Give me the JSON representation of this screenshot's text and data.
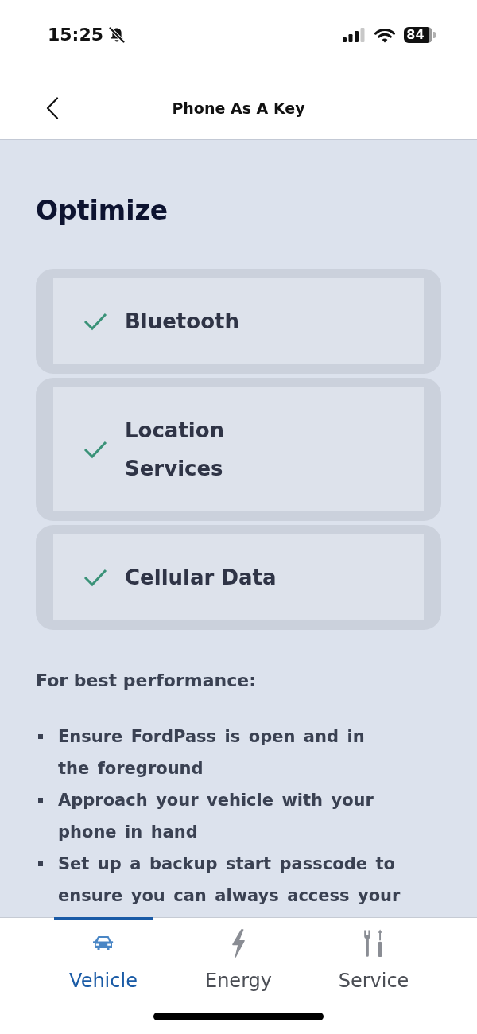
{
  "status_bar": {
    "time": "15:25",
    "battery": "84"
  },
  "header": {
    "title": "Phone As A Key"
  },
  "optimize": {
    "heading": "Optimize",
    "items": [
      {
        "label": "Bluetooth",
        "checked": true
      },
      {
        "label": "Location Services",
        "checked": true
      },
      {
        "label": "Cellular Data",
        "checked": true
      }
    ],
    "tips_heading": "For best performance:",
    "tips": [
      "Ensure FordPass is open and in the foreground",
      "Approach your vehicle with your phone in hand",
      "Set up a backup start passcode to ensure you can always access your"
    ]
  },
  "tab_bar": {
    "tabs": [
      {
        "label": "Vehicle",
        "kind": "vehicle",
        "selected": true
      },
      {
        "label": "Energy",
        "kind": "energy",
        "selected": false
      },
      {
        "label": "Service",
        "kind": "service",
        "selected": false
      }
    ]
  }
}
